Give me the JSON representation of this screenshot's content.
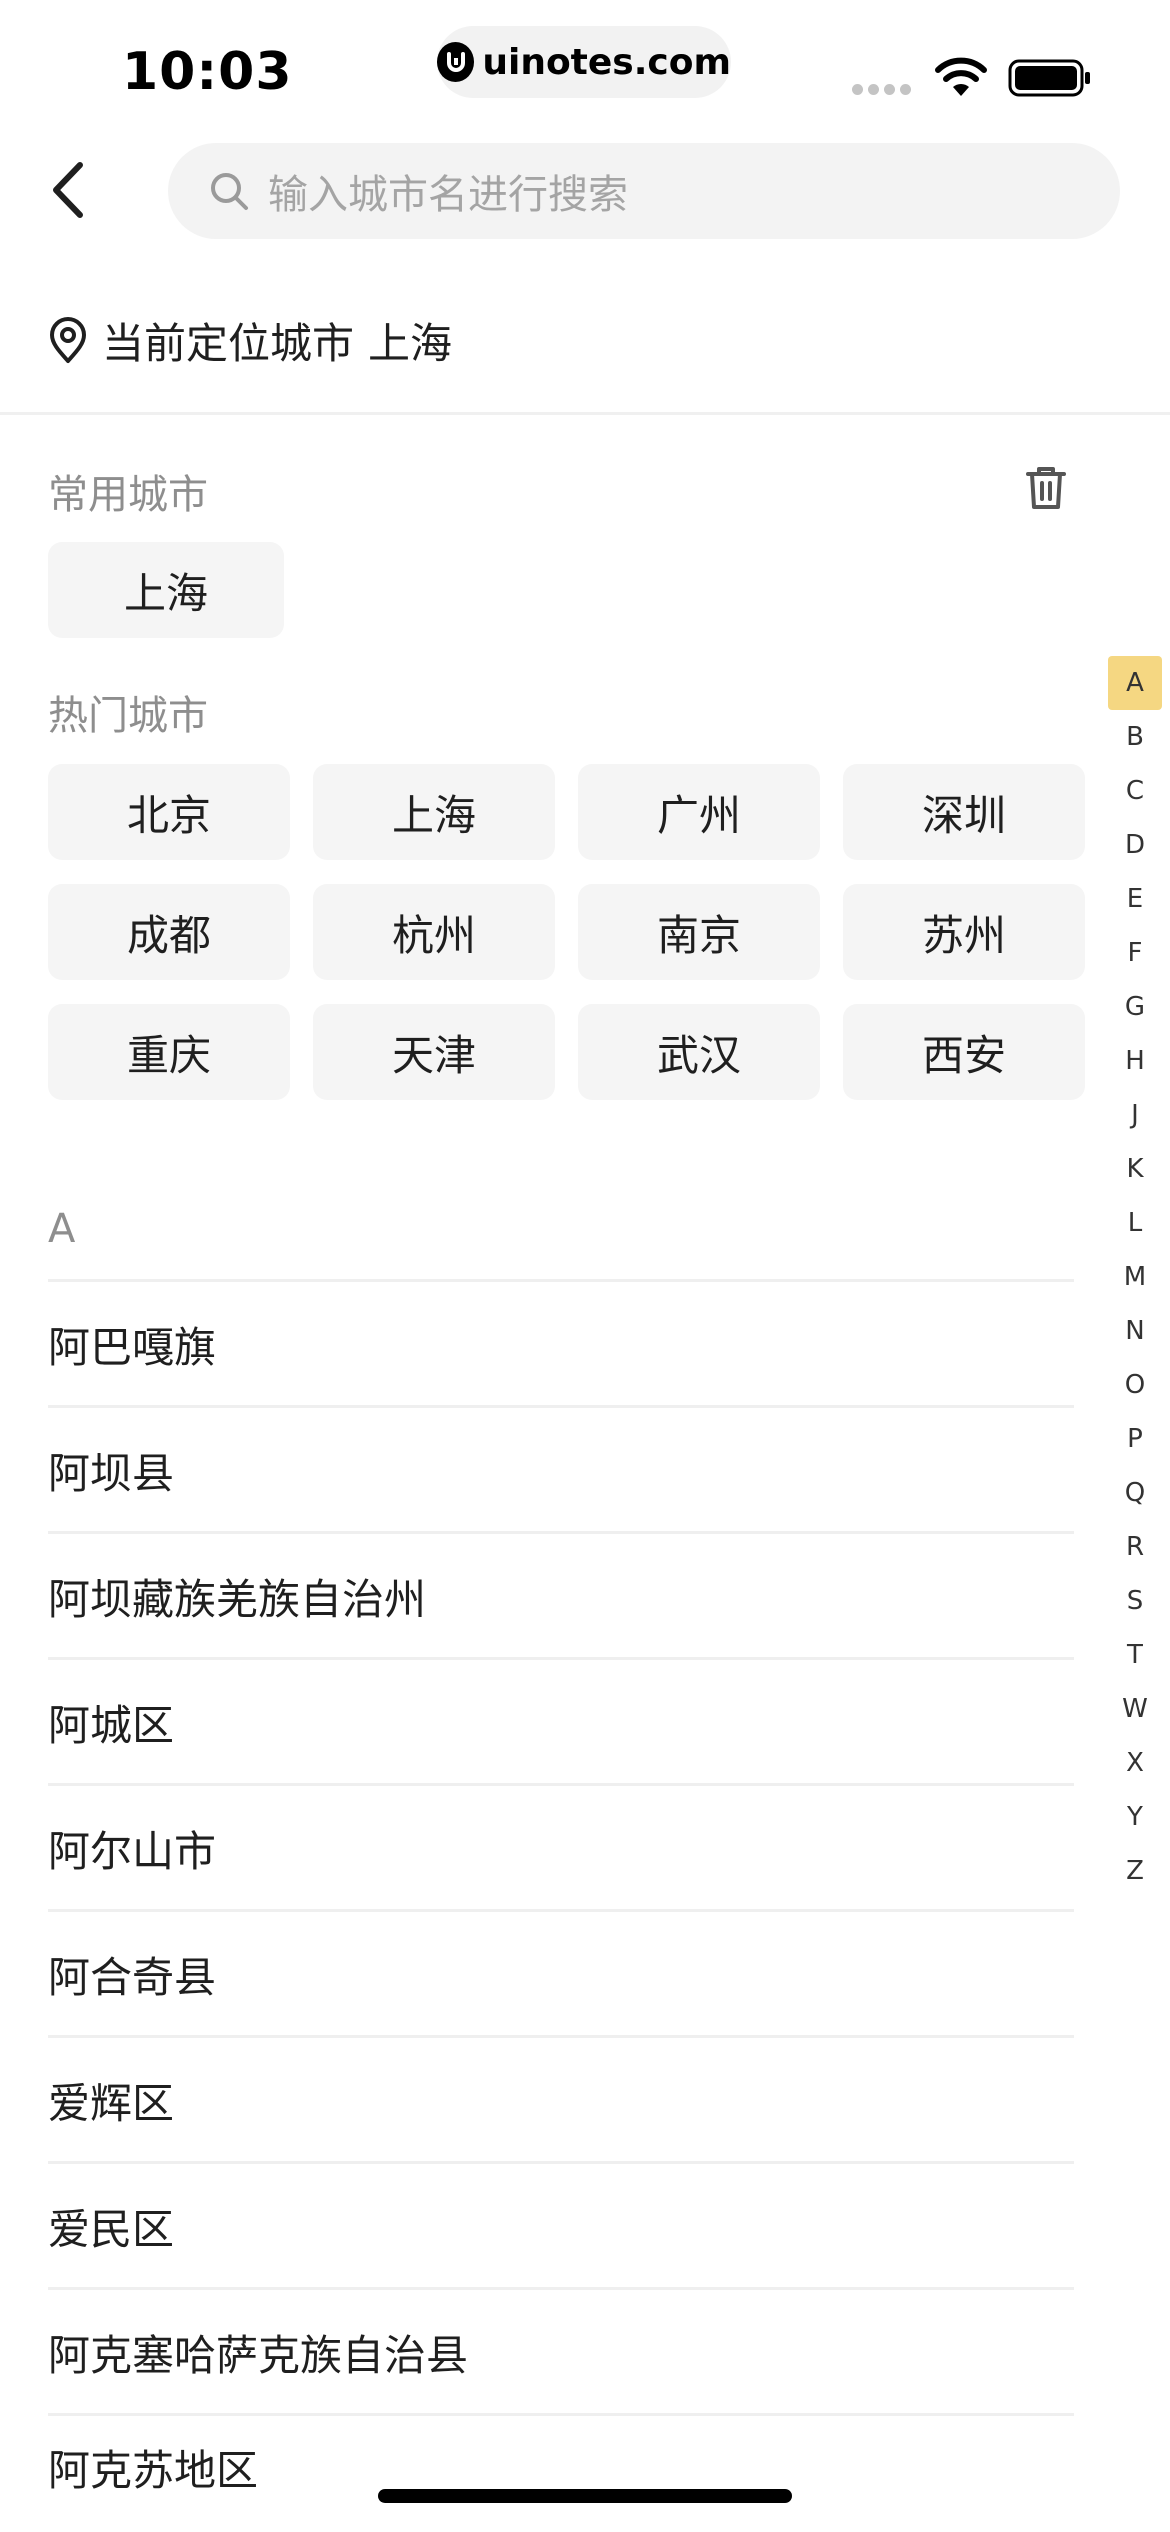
{
  "status_bar": {
    "time": "10:03",
    "url": "uinotes.com"
  },
  "search": {
    "placeholder": "输入城市名进行搜索"
  },
  "location": {
    "label": "当前定位城市",
    "city": "上海"
  },
  "common_cities": {
    "title": "常用城市",
    "items": [
      "上海"
    ]
  },
  "hot_cities": {
    "title": "热门城市",
    "items": [
      "北京",
      "上海",
      "广州",
      "深圳",
      "成都",
      "杭州",
      "南京",
      "苏州",
      "重庆",
      "天津",
      "武汉",
      "西安"
    ]
  },
  "alpha_index": {
    "active": "A",
    "letters": [
      "A",
      "B",
      "C",
      "D",
      "E",
      "F",
      "G",
      "H",
      "J",
      "K",
      "L",
      "M",
      "N",
      "O",
      "P",
      "Q",
      "R",
      "S",
      "T",
      "W",
      "X",
      "Y",
      "Z"
    ]
  },
  "city_list": {
    "letter": "A",
    "items": [
      "阿巴嘎旗",
      "阿坝县",
      "阿坝藏族羌族自治州",
      "阿城区",
      "阿尔山市",
      "阿合奇县",
      "爱辉区",
      "爱民区",
      "阿克塞哈萨克族自治县",
      "阿克苏地区"
    ]
  },
  "colors": {
    "accent": "#f5d782",
    "chip_bg": "#f5f5f5",
    "search_bg": "#f3f3f3",
    "muted_text": "#8e8e8e"
  }
}
